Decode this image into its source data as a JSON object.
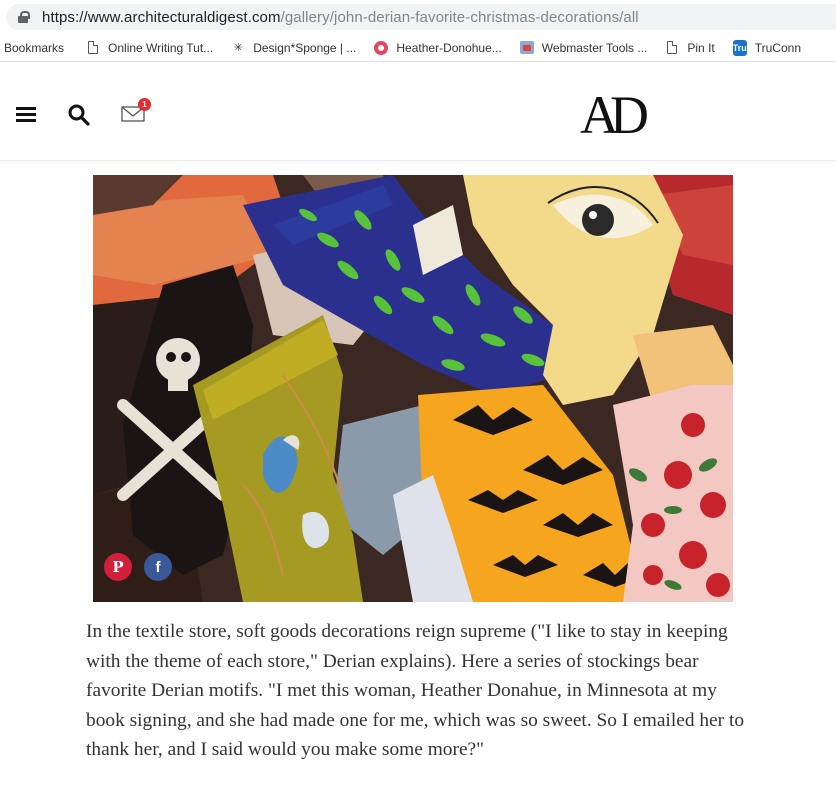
{
  "browser": {
    "url_host": "https://www.architecturaldigest.com",
    "url_path": "/gallery/john-derian-favorite-christmas-decorations/all"
  },
  "bookmarks": [
    {
      "label": "Bookmarks",
      "icon": "none"
    },
    {
      "label": "Online Writing Tut...",
      "icon": "document-icon"
    },
    {
      "label": "Design*Sponge | ...",
      "icon": "sparkle-icon"
    },
    {
      "label": "Heather-Donohue...",
      "icon": "site-icon"
    },
    {
      "label": "Webmaster Tools ...",
      "icon": "webmaster-icon"
    },
    {
      "label": "Pin It",
      "icon": "document-icon"
    },
    {
      "label": "TruConn",
      "icon": "truconn-icon"
    }
  ],
  "header": {
    "logo": "AD",
    "mail_badge_count": "1"
  },
  "gallery": {
    "share_pinterest": "P",
    "share_facebook": "f"
  },
  "caption": "In the textile store, soft goods decorations reign supreme (\"I like to stay in keeping with the theme of each store,\" Derian explains). Here a series of stockings bear favorite Derian motifs. \"I met this woman, Heather Donahue, in Minnesota at my book signing, and she had made one for me, which was so sweet. So I emailed her to thank her, and I said would you make some more?\"",
  "colors": {
    "pinterest": "#d21f3c",
    "facebook": "#3b5998",
    "badge": "#e52b2b"
  }
}
